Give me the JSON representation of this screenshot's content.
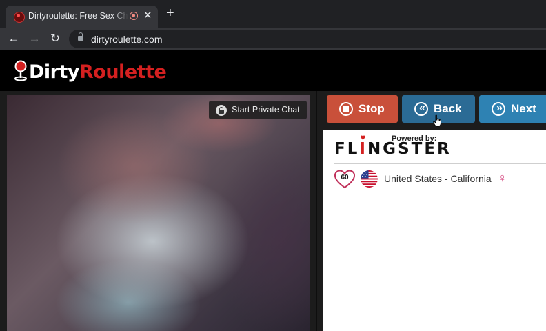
{
  "browser": {
    "tab_title": "Dirtyroulette: Free Sex Chat",
    "tab_close": "✕",
    "new_tab": "+",
    "url": "dirtyroulette.com",
    "back_glyph": "←",
    "forward_glyph": "→",
    "reload_glyph": "↻"
  },
  "site": {
    "logo_part1": "Dirty",
    "logo_part2": "Roulette",
    "brand_color": "#d42020"
  },
  "video": {
    "private_chat_label": "Start Private Chat"
  },
  "controls": {
    "stop_label": "Stop",
    "back_label": "Back",
    "next_label": "Next",
    "back_chevron": "«",
    "next_chevron": "»",
    "stop_color": "#c9503a",
    "back_color": "#2b6b95",
    "next_color": "#2e82b3"
  },
  "partner": {
    "powered_by": "Powered by:",
    "brand_f": "FL",
    "brand_i": "I",
    "brand_rest": "NGSTER",
    "score": "60",
    "location": "United States - California",
    "gender_glyph": "♀"
  }
}
